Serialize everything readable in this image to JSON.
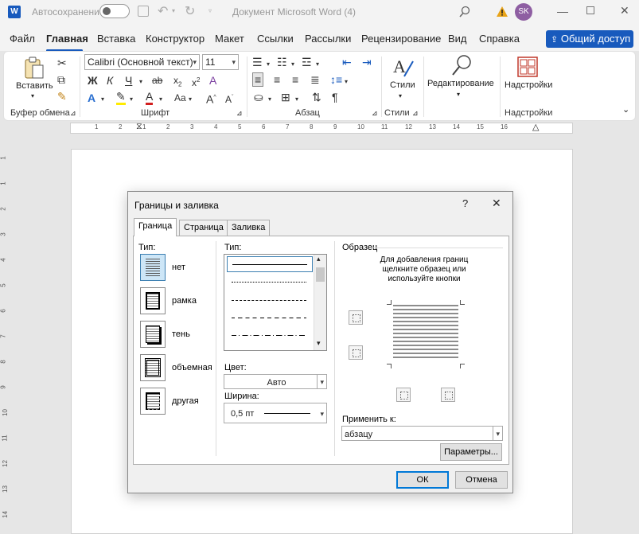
{
  "app": {
    "autosave_label": "Автосохранение",
    "doc_title": "Документ Microsoft Word (4)",
    "user_initials": "SK"
  },
  "menu": {
    "items": [
      "Файл",
      "Главная",
      "Вставка",
      "Конструктор",
      "Макет",
      "Ссылки",
      "Рассылки",
      "Рецензирование",
      "Вид",
      "Справка"
    ],
    "share_label": "Общий доступ"
  },
  "ribbon": {
    "paste_label": "Вставить",
    "font_name": "Calibri (Основной текст)",
    "font_size": "11",
    "styles_label": "Стили",
    "editing_label": "Редактирование",
    "addins_label": "Надстройки",
    "groups": {
      "clipboard": "Буфер обмена",
      "font": "Шрифт",
      "paragraph": "Абзац",
      "styles": "Стили",
      "addins": "Надстройки"
    }
  },
  "ruler": {
    "ticks": [
      "1",
      "2",
      "1",
      "2",
      "3",
      "4",
      "5",
      "6",
      "7",
      "8",
      "9",
      "10",
      "11",
      "12",
      "13",
      "14",
      "15",
      "16"
    ],
    "vticks": [
      "1",
      "1",
      "2",
      "3",
      "4",
      "5",
      "6",
      "7",
      "8",
      "9",
      "10",
      "11",
      "12",
      "13",
      "14"
    ]
  },
  "dialog": {
    "title": "Границы и заливка",
    "help": "?",
    "close": "✕",
    "tabs": [
      "Граница",
      "Страница",
      "Заливка"
    ],
    "setting_label": "Тип:",
    "settings": [
      "нет",
      "рамка",
      "тень",
      "объемная",
      "другая"
    ],
    "style_label": "Тип:",
    "color_label": "Цвет:",
    "color_value": "Авто",
    "width_label": "Ширина:",
    "width_value": "0,5 пт",
    "preview_label": "Образец",
    "preview_hint": "Для добавления границ щелкните образец или используйте кнопки",
    "apply_to_label": "Применить к:",
    "apply_to_value": "абзацу",
    "options_button": "Параметры...",
    "ok_button": "ОК",
    "cancel_button": "Отмена"
  }
}
